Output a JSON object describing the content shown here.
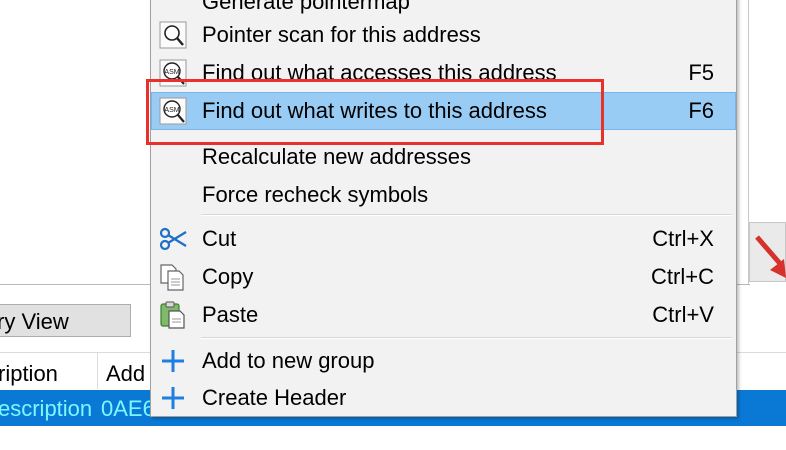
{
  "background": {
    "memory_view_label": "ry View",
    "table": {
      "columns": [
        "ription",
        "Add"
      ],
      "selected_row": {
        "description": "escription",
        "address": "0AE6"
      }
    }
  },
  "context_menu": {
    "items": [
      {
        "label": "Generate pointermap",
        "shortcut": "",
        "icon": "none"
      },
      {
        "label": "Pointer scan for this address",
        "shortcut": "",
        "icon": "magnifier-icon"
      },
      {
        "label": "Find out what accesses this address",
        "shortcut": "F5",
        "icon": "asm-magnifier-icon"
      },
      {
        "label": "Find out what writes to this address",
        "shortcut": "F6",
        "icon": "asm-magnifier-icon",
        "highlighted": true
      },
      {
        "label": "Recalculate new addresses",
        "shortcut": "",
        "icon": "none"
      },
      {
        "label": "Force recheck symbols",
        "shortcut": "",
        "icon": "none"
      },
      {
        "label": "Cut",
        "shortcut": "Ctrl+X",
        "icon": "scissors-icon"
      },
      {
        "label": "Copy",
        "shortcut": "Ctrl+C",
        "icon": "copy-icon"
      },
      {
        "label": "Paste",
        "shortcut": "Ctrl+V",
        "icon": "paste-icon"
      },
      {
        "label": "Add to new group",
        "shortcut": "",
        "icon": "plus-icon"
      },
      {
        "label": "Create Header",
        "shortcut": "",
        "icon": "plus-icon"
      }
    ]
  },
  "colors": {
    "highlight": "#99ccf5",
    "annotation_red": "#e8312b",
    "selected_row": "#0a79d6",
    "selected_text": "#7cf7ff",
    "plus_blue": "#1e7fe0"
  }
}
